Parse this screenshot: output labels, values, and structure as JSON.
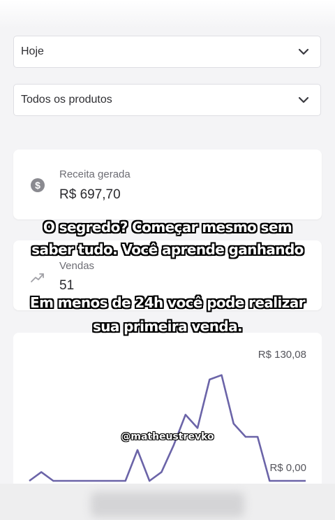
{
  "filters": {
    "period": "Hoje",
    "product": "Todos os produtos"
  },
  "cards": {
    "revenue": {
      "title": "Receita gerada",
      "value": "R$ 697,70",
      "icon": "dollar-coin-icon"
    },
    "sales": {
      "title": "Vendas",
      "value": "51",
      "icon": "trend-up-icon"
    }
  },
  "chart_data": {
    "type": "line",
    "ytick_labels": [
      "R$ 130,08",
      "R$ 0,00"
    ],
    "ylim": [
      0,
      130.08
    ],
    "y": [
      0,
      10,
      0,
      0,
      0,
      0,
      0,
      0,
      0,
      35,
      0,
      10,
      40,
      75,
      60,
      115,
      120,
      65,
      50,
      50,
      0,
      0,
      0,
      0
    ],
    "grid": false,
    "color": "#6b64a8"
  },
  "overlay": {
    "caption_line_1": "O segredo? Começar mesmo sem",
    "caption_line_2": "saber tudo. Você aprende ganhando",
    "caption_line_3": "Em menos de 24h você pode realizar",
    "caption_line_4": "sua primeira venda.",
    "handle": "@matheustrevko"
  }
}
